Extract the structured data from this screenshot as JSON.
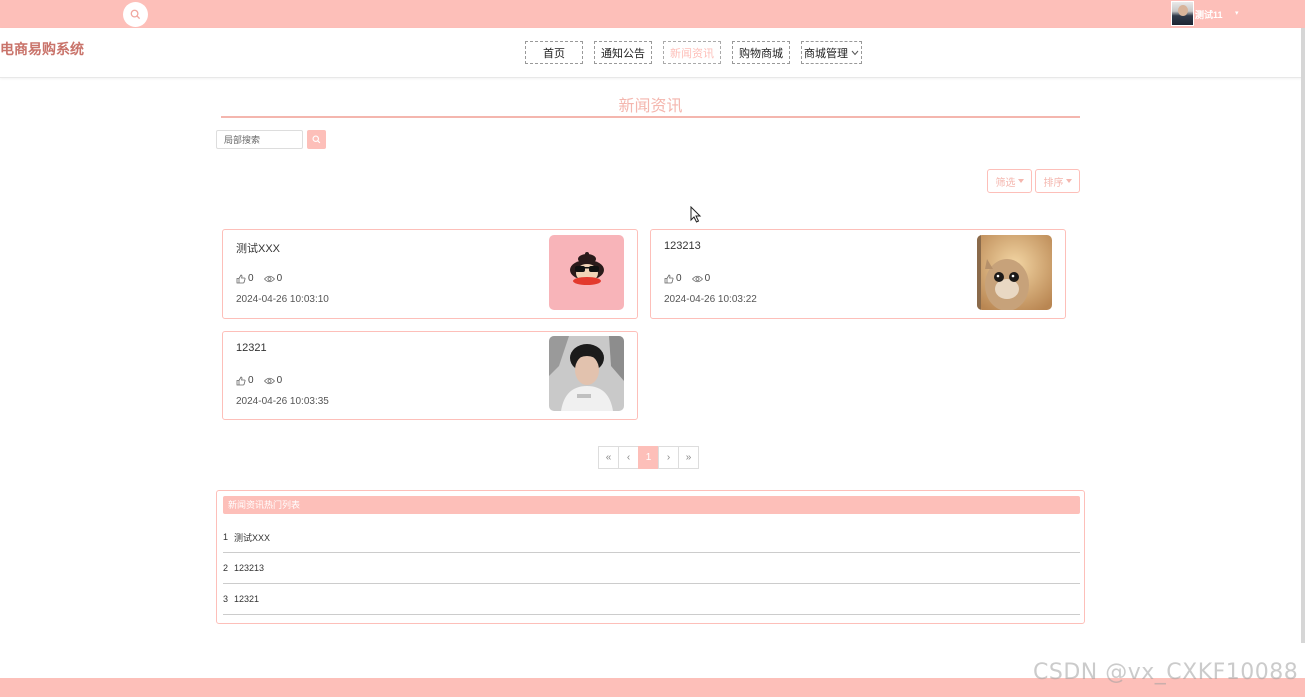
{
  "topbar": {
    "user_name": "测试11",
    "caret": "▾"
  },
  "header": {
    "brand": "电商易购系统",
    "nav": [
      {
        "label": "首页"
      },
      {
        "label": "通知公告"
      },
      {
        "label": "新闻资讯"
      },
      {
        "label": "购物商城"
      },
      {
        "label": "商城管理"
      }
    ]
  },
  "main": {
    "section_title": "新闻资讯",
    "search": {
      "placeholder": "局部搜索"
    },
    "filter_label": "筛选",
    "sort_label": "排序",
    "cards": [
      {
        "title": "测试XXX",
        "likes": "0",
        "views": "0",
        "time": "2024-04-26 10:03:10"
      },
      {
        "title": "123213",
        "likes": "0",
        "views": "0",
        "time": "2024-04-26 10:03:22"
      },
      {
        "title": "12321",
        "likes": "0",
        "views": "0",
        "time": "2024-04-26 10:03:35"
      }
    ],
    "pagination": {
      "first": "«",
      "prev": "‹",
      "current": "1",
      "next": "›",
      "last": "»"
    }
  },
  "hot_list": {
    "title": "新闻资讯热门列表",
    "items": [
      {
        "rank": "1",
        "title": "测试XXX"
      },
      {
        "rank": "2",
        "title": "123213"
      },
      {
        "rank": "3",
        "title": "12321"
      }
    ]
  },
  "watermark": "CSDN @vx_CXKF10088",
  "colors": {
    "accent": "#fdbfb9",
    "title": "#f4b6ae",
    "brand": "#c9736a"
  }
}
